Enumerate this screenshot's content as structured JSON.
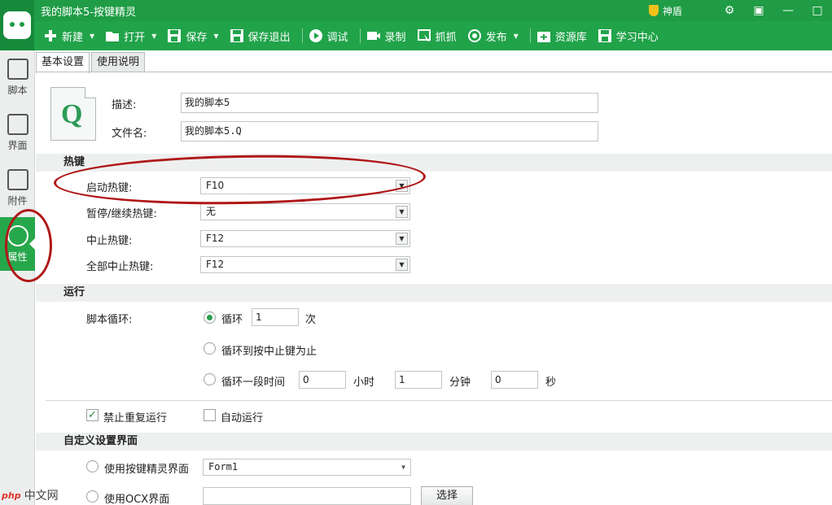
{
  "window": {
    "title": "我的脚本5-按键精灵",
    "shield_label": "神盾",
    "gear_icon": "gear-icon",
    "restore_icon": "restore-icon",
    "minimize_icon": "minimize-icon",
    "maximize_icon": "maximize-icon"
  },
  "toolbar": {
    "items": [
      {
        "label": "新建",
        "icon": "plus-icon"
      },
      {
        "label": "打开",
        "icon": "folder-icon"
      },
      {
        "label": "保存",
        "icon": "save-icon"
      },
      {
        "label": "保存退出",
        "icon": "save-exit-icon"
      },
      {
        "label": "调试",
        "icon": "play-icon"
      },
      {
        "label": "录制",
        "icon": "camera-icon"
      },
      {
        "label": "抓抓",
        "icon": "grab-icon"
      },
      {
        "label": "发布",
        "icon": "publish-icon"
      },
      {
        "label": "资源库",
        "icon": "library-icon"
      },
      {
        "label": "学习中心",
        "icon": "learn-icon"
      }
    ]
  },
  "sidebar": {
    "items": [
      {
        "label": "脚本",
        "icon": "code-icon"
      },
      {
        "label": "界面",
        "icon": "grid-icon"
      },
      {
        "label": "附件",
        "icon": "attachment-icon"
      },
      {
        "label": "属性",
        "icon": "properties-icon",
        "active": true
      }
    ]
  },
  "tabs": [
    {
      "label": "基本设置",
      "active": true
    },
    {
      "label": "使用说明"
    }
  ],
  "basic": {
    "description_label": "描述:",
    "description_value": "我的脚本5",
    "filename_label": "文件名:",
    "filename_value": "我的脚本5.Q",
    "file_icon_letter": "Q"
  },
  "hotkeys": {
    "section_title": "热键",
    "rows": [
      {
        "label": "启动热键:",
        "value": "F10"
      },
      {
        "label": "暂停/继续热键:",
        "value": "无"
      },
      {
        "label": "中止热键:",
        "value": "F12"
      },
      {
        "label": "全部中止热键:",
        "value": "F12"
      }
    ]
  },
  "run": {
    "section_title": "运行",
    "loop_label": "脚本循环:",
    "option1_label": "循环",
    "option1_count": "1",
    "option1_unit": "次",
    "option2_label": "循环到按中止键为止",
    "option3_label": "循环一段时间",
    "hours_value": "0",
    "hours_unit": "小时",
    "minutes_value": "1",
    "minutes_unit": "分钟",
    "seconds_value": "0",
    "seconds_unit": "秒",
    "no_repeat_label": "禁止重复运行",
    "auto_run_label": "自动运行"
  },
  "custom_ui": {
    "section_title": "自定义设置界面",
    "option1_label": "使用按键精灵界面",
    "option1_value": "Form1",
    "option2_label": "使用OCX界面",
    "option2_value": "",
    "browse_label": "选择"
  },
  "watermark": {
    "brand": "php",
    "text": "中文网"
  },
  "colors": {
    "accent": "#21a34a",
    "annotation": "#b01818"
  }
}
